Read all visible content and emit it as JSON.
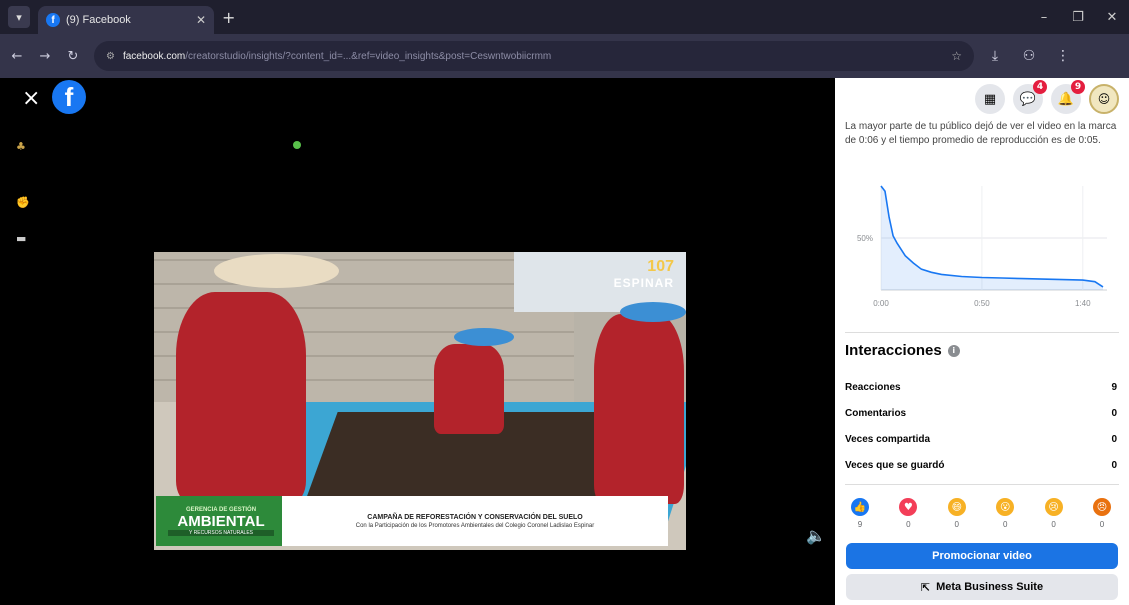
{
  "browser": {
    "tab_title": "(9) Facebook",
    "tab_icon": "f",
    "url_domain": "facebook.com",
    "url_path": "/creatorstudio/insights/?content_id=...&ref=video_insights&post=Ceswntwobiicrmm"
  },
  "viewer": {
    "close_label": "×",
    "logo_letter": "f",
    "video": {
      "station_number": "107",
      "station_name": "ESPINAR",
      "banner_left_top": "GERENCIA DE GESTIÓN",
      "banner_left_main": "AMBIENTAL",
      "banner_left_bottom": "Y RECURSOS NATURALES",
      "banner_headline": "CAMPAÑA DE REFORESTACIÓN Y CONSERVACIÓN DEL SUELO",
      "banner_sub": "Con la Participación de los Promotores Ambientales del Colegio Coronel Ladislao Espinar"
    }
  },
  "panel": {
    "header_badges": {
      "messenger": "4",
      "notifications": "9"
    },
    "summary_text": "La mayor parte de tu público dejó de ver el video en la marca de 0:06 y el tiempo promedio de reproducción es de 0:05.",
    "interactions_title": "Interacciones",
    "stats": [
      {
        "label": "Reacciones",
        "value": "9"
      },
      {
        "label": "Comentarios",
        "value": "0"
      },
      {
        "label": "Veces compartida",
        "value": "0"
      },
      {
        "label": "Veces que se guardó",
        "value": "0"
      }
    ],
    "reactions": [
      {
        "name": "like",
        "color": "#1877f2",
        "glyph": "👍",
        "count": "9"
      },
      {
        "name": "love",
        "color": "#f33e58",
        "glyph": "♥",
        "count": "0"
      },
      {
        "name": "haha",
        "color": "#f7b125",
        "glyph": "😄",
        "count": "0"
      },
      {
        "name": "wow",
        "color": "#f7b125",
        "glyph": "😮",
        "count": "0"
      },
      {
        "name": "sad",
        "color": "#f7b125",
        "glyph": "😢",
        "count": "0"
      },
      {
        "name": "angry",
        "color": "#e9710f",
        "glyph": "😠",
        "count": "0"
      }
    ],
    "promote_label": "Promocionar video",
    "meta_label": "Meta Business Suite"
  },
  "chart_data": {
    "type": "area",
    "x_ticks": [
      "0:00",
      "0:50",
      "1:40"
    ],
    "y_ticks": [
      "50%"
    ],
    "xlim": [
      0,
      112
    ],
    "ylim": [
      0,
      100
    ],
    "series": [
      {
        "x": [
          0,
          2,
          4,
          6,
          8,
          12,
          16,
          20,
          25,
          30,
          40,
          50,
          60,
          70,
          80,
          90,
          100,
          106,
          110
        ],
        "y": [
          100,
          95,
          70,
          52,
          45,
          33,
          26,
          20,
          17,
          15,
          13,
          12,
          11.5,
          11,
          10.5,
          10,
          9.5,
          8,
          3
        ]
      }
    ]
  }
}
